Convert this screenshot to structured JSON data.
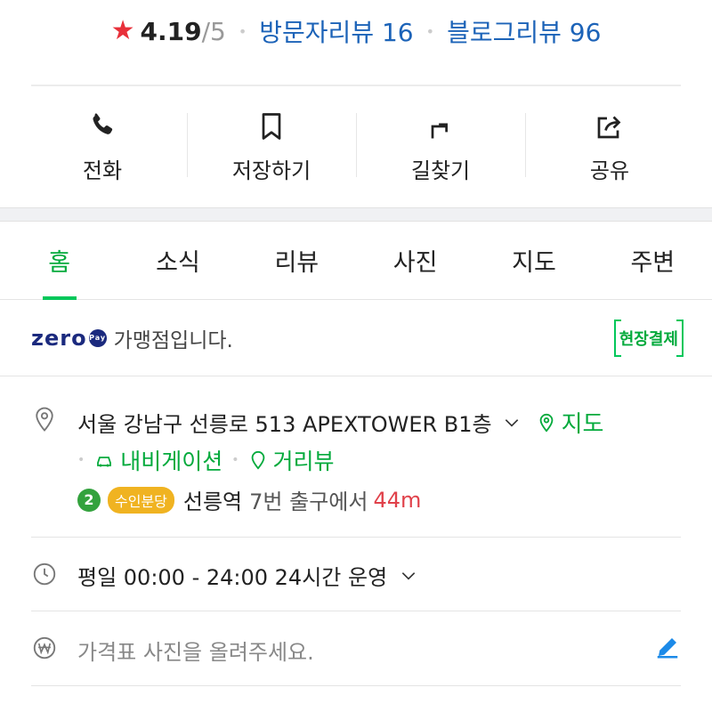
{
  "rating": {
    "score": "4.19",
    "out_of": "/5",
    "visitor_reviews": "방문자리뷰 16",
    "blog_reviews": "블로그리뷰 96"
  },
  "actions": [
    {
      "label": "전화",
      "icon": "phone-icon"
    },
    {
      "label": "저장하기",
      "icon": "bookmark-icon"
    },
    {
      "label": "길찾기",
      "icon": "directions-icon"
    },
    {
      "label": "공유",
      "icon": "share-icon"
    }
  ],
  "tabs": [
    {
      "label": "홈",
      "active": true
    },
    {
      "label": "소식"
    },
    {
      "label": "리뷰"
    },
    {
      "label": "사진"
    },
    {
      "label": "지도"
    },
    {
      "label": "주변"
    }
  ],
  "zeropay": {
    "logo_text": "zero",
    "logo_badge": "Pay",
    "text": "가맹점입니다.",
    "badge": "현장결제"
  },
  "address": {
    "text": "서울 강남구 선릉로 513 APEXTOWER B1층",
    "map_link": "지도",
    "navigation_link": "내비게이션",
    "street_view_link": "거리뷰"
  },
  "subway": {
    "line_number": "2",
    "line_name": "수인분당",
    "station": "선릉역",
    "exit_text": "7번 출구에서",
    "distance": "44m"
  },
  "hours": {
    "text": "평일 00:00 - 24:00 24시간 운영"
  },
  "price": {
    "placeholder": "가격표 사진을 올려주세요."
  },
  "colors": {
    "accent_green": "#03c75a",
    "link_blue": "#1c63b8",
    "star_red": "#e8303a",
    "distance_red": "#e0414a",
    "subway_line2": "#33a23d",
    "subway_suin": "#f0b321",
    "zeropay_navy": "#1b2a7e"
  }
}
